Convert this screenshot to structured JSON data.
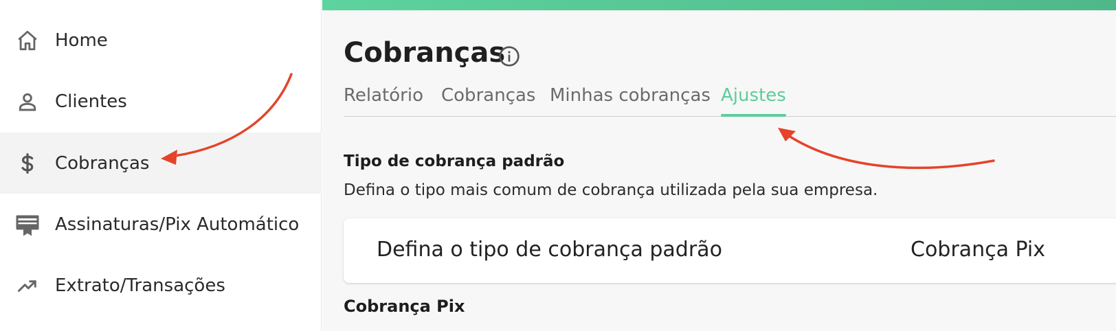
{
  "sidebar": {
    "items": [
      {
        "label": "Home",
        "icon": "home-icon"
      },
      {
        "label": "Clientes",
        "icon": "person-icon"
      },
      {
        "label": "Cobranças",
        "icon": "dollar-icon",
        "active": true
      },
      {
        "label": "Assinaturas/Pix Automático",
        "icon": "subscription-card-icon"
      },
      {
        "label": "Extrato/Transações",
        "icon": "trending-up-icon"
      }
    ]
  },
  "header": {
    "title": "Cobranças",
    "info_icon": "info-icon"
  },
  "tabs": [
    {
      "label": "Relatório"
    },
    {
      "label": "Cobranças"
    },
    {
      "label": "Minhas cobranças"
    },
    {
      "label": "Ajustes",
      "active": true
    }
  ],
  "settings": {
    "default_type": {
      "title": "Tipo de cobrança padrão",
      "description": "Defina o tipo mais comum de cobrança utilizada pela sua empresa.",
      "field_label": "Defina o tipo de cobrança padrão",
      "field_value": "Cobrança Pix"
    },
    "pix_section": {
      "title": "Cobrança Pix"
    }
  },
  "colors": {
    "accent": "#5dcc9b",
    "annotation_arrow": "#e5432a",
    "topbar": "#5dd39e",
    "active_nav_bg": "#f3f3f3"
  }
}
